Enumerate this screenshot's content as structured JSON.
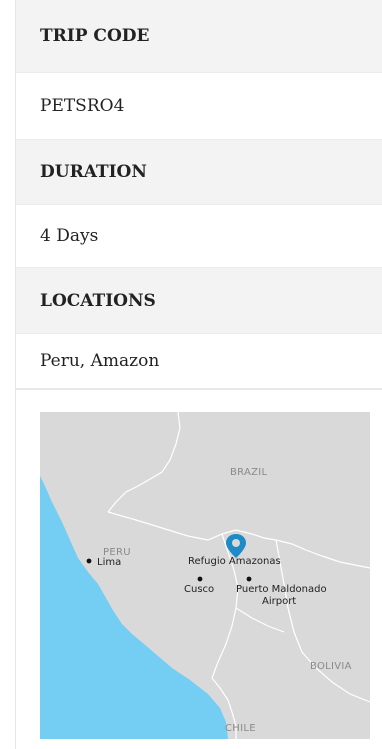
{
  "trip": {
    "code_label": "TRIP CODE",
    "code_value": "PETSRO4",
    "duration_label": "DURATION",
    "duration_value": "4 Days",
    "locations_label": "LOCATIONS",
    "locations_value": "Peru, Amazon"
  },
  "map": {
    "countries": {
      "brazil": "BRAZIL",
      "peru": "PERU",
      "bolivia": "BOLIVIA",
      "chile": "CHILE"
    },
    "places": {
      "lima": "Lima",
      "refugio": "Refugio Amazonas",
      "cusco": "Cusco",
      "puerto_line1": "Puerto Maldonado",
      "puerto_line2": "Airport"
    },
    "colors": {
      "land": "#d9d9d9",
      "ocean": "#74cdf2",
      "border": "#ffffff",
      "pin": "#1f8ac8"
    },
    "pin_icon": "map-pin-icon"
  }
}
